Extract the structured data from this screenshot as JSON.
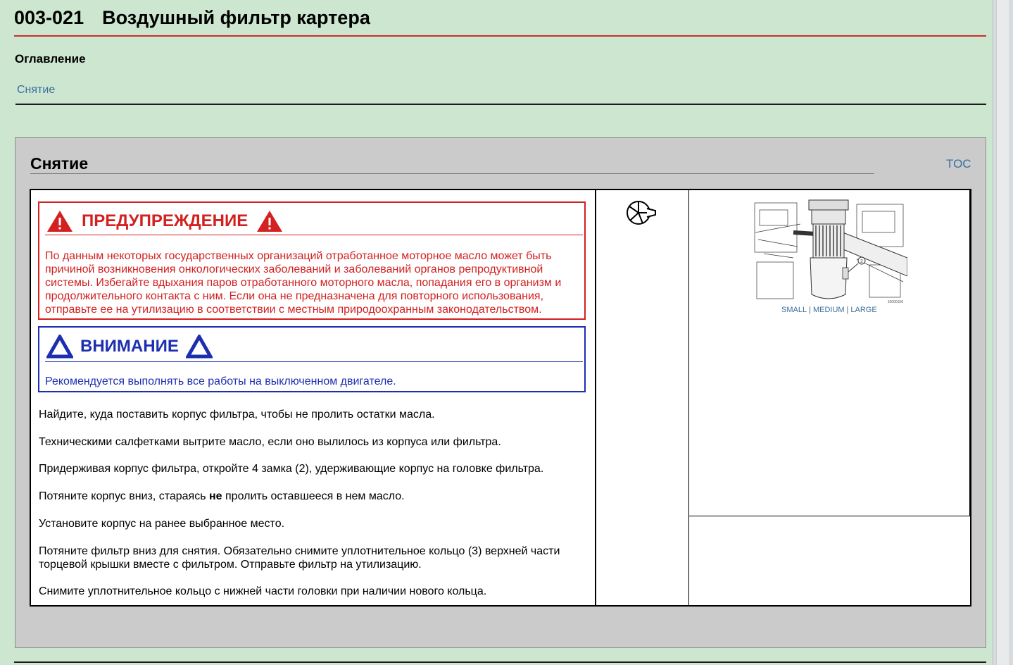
{
  "document": {
    "code": "003-021",
    "title": "Воздушный фильтр картера",
    "toc_heading": "Оглавление",
    "toc_items": [
      "Снятие"
    ]
  },
  "section": {
    "title": "Снятие",
    "toc_link": "TOC",
    "warning": {
      "heading": "ПРЕДУПРЕЖДЕНИЕ",
      "color": "#d32020",
      "lines": [
        "По данным некоторых государственных организаций отработанное моторное масло может быть",
        "причиной возникновения онкологических заболеваний и заболеваний органов репродуктивной",
        "системы. Избегайте вдыхания паров отработанного моторного масла, попадания его в организм и",
        "продолжительного контакта с ним. Если она не предназначена для повторного использования,",
        "отправьте ее на утилизацию в соответствии с местным природоохранным законодательством."
      ]
    },
    "caution": {
      "heading": "ВНИМАНИЕ",
      "color": "#1b2fb0",
      "text": "Рекомендуется выполнять все работы на выключенном двигателе."
    },
    "steps": {
      "s1": "Найдите, куда поставить корпус фильтра, чтобы не пролить остатки масла.",
      "s2": "Техническими салфетками вытрите масло, если оно вылилось из корпуса или фильтра.",
      "s3": "Придерживая корпус фильтра, откройте 4 замка (2), удерживающие корпус на головке фильтра.",
      "s4_before": "Потяните корпус вниз, стараясь ",
      "s4_bold": "не",
      "s4_after": " пролить оставшееся в нем масло.",
      "s5": "Установите корпус на ранее выбранное место.",
      "s6_line1": "Потяните фильтр вниз для снятия. Обязательно снимите уплотнительное кольцо (3) верхней части",
      "s6_line2": "торцевой крышки вместе с фильтром. Отправьте фильтр на утилизацию.",
      "s7": "Снимите уплотнительное кольцо с нижней части головки при наличии нового кольца."
    },
    "image": {
      "callout": "2",
      "figure_id": "10000156",
      "sizes": [
        "SMALL",
        "MEDIUM",
        "LARGE"
      ]
    },
    "tool_icon": "wrench-tool-icon"
  },
  "colors": {
    "page_bg": "#cde6d0",
    "section_bg": "#cbcbcb",
    "link": "#3a6f9e",
    "title_rule": "#c8302a"
  }
}
